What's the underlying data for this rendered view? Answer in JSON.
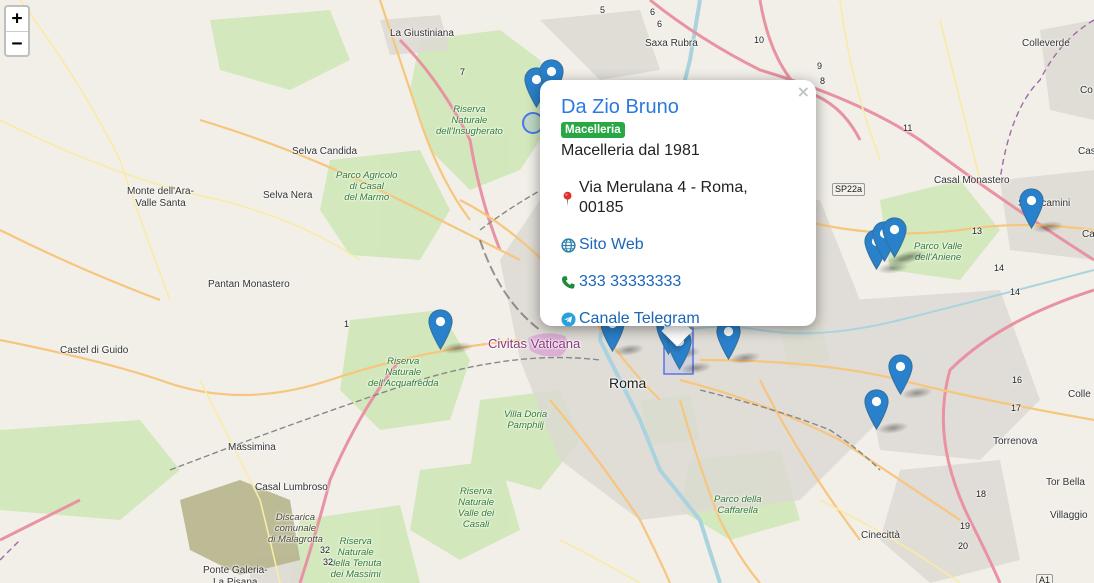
{
  "map": {
    "zoom_in": "+",
    "zoom_out": "−",
    "labels": {
      "la_giustiniana": "La Giustiniana",
      "saxa_rubra": "Saxa Rubra",
      "colleverde": "Colleverde",
      "co": "Co",
      "selva_candida": "Selva Candida",
      "monte_ara": "Monte dell'Ara-\nValle Santa",
      "selva_nera": "Selva Nera",
      "pantan_monastero": "Pantan Monastero",
      "castel_di_guido": "Castel di Guido",
      "massimina": "Massimina",
      "casal_lumbroso": "Casal Lumbroso",
      "ponte_galeria": "Ponte Galeria-\nLa Pisana",
      "casal_monastero": "Casal Monastero",
      "settecamini": "Settecamini",
      "cas": "Cas",
      "colle": "Colle",
      "torrenova": "Torrenova",
      "tor_bella": "Tor Bella",
      "villaggio": "Villaggio",
      "cinecitta": "Cinecittà",
      "roma": "Roma",
      "civitas_vaticana": "Civitas Vaticana",
      "sp22a": "SP22a",
      "a1": "A1"
    },
    "parks": {
      "insugherato": "Riserva\nNaturale\ndell'Insugherato",
      "casal_marmo": "Parco Agricolo\ndi Casal\ndel Marmo",
      "acquafredda": "Riserva\nNaturale\ndell'Acquafredda",
      "doria_pamphilj": "Villa Doria\nPamphilj",
      "valle_galeria": "Riserva\nNaturale\nValle dei\nCasali",
      "tenuta_massimi": "Riserva\nNaturale\ndella Tenuta\ndei Massimi",
      "valle_aniene": "Parco Valle\ndell'Aniene",
      "caffarella": "Parco della\nCaffarella",
      "malagrotta": "Discarica\ncomunale\ndi Malagrotta"
    },
    "road_numbers": [
      "6",
      "6",
      "5",
      "10",
      "9",
      "8",
      "11",
      "13",
      "14",
      "14",
      "16",
      "17",
      "18",
      "19",
      "20",
      "32",
      "32",
      "1",
      "7"
    ]
  },
  "popup": {
    "close": "×",
    "title": "Da Zio Bruno",
    "badge": "Macelleria",
    "description": "Macelleria dal 1981",
    "address": "Via Merulana 4 - Roma, 00185",
    "website": "Sito Web",
    "phone": "333 33333333",
    "telegram": "Canale Telegram",
    "icons": {
      "address": "map-pin-icon",
      "website": "globe-icon",
      "phone": "phone-icon",
      "telegram": "telegram-icon"
    }
  },
  "colors": {
    "marker": "#2a81cb",
    "badge": "#28a745",
    "link": "#1a66b8",
    "title": "#2a7ae2",
    "motorway": "#e892a2",
    "primary": "#fcd6a4",
    "park": "#c8e6b0"
  }
}
